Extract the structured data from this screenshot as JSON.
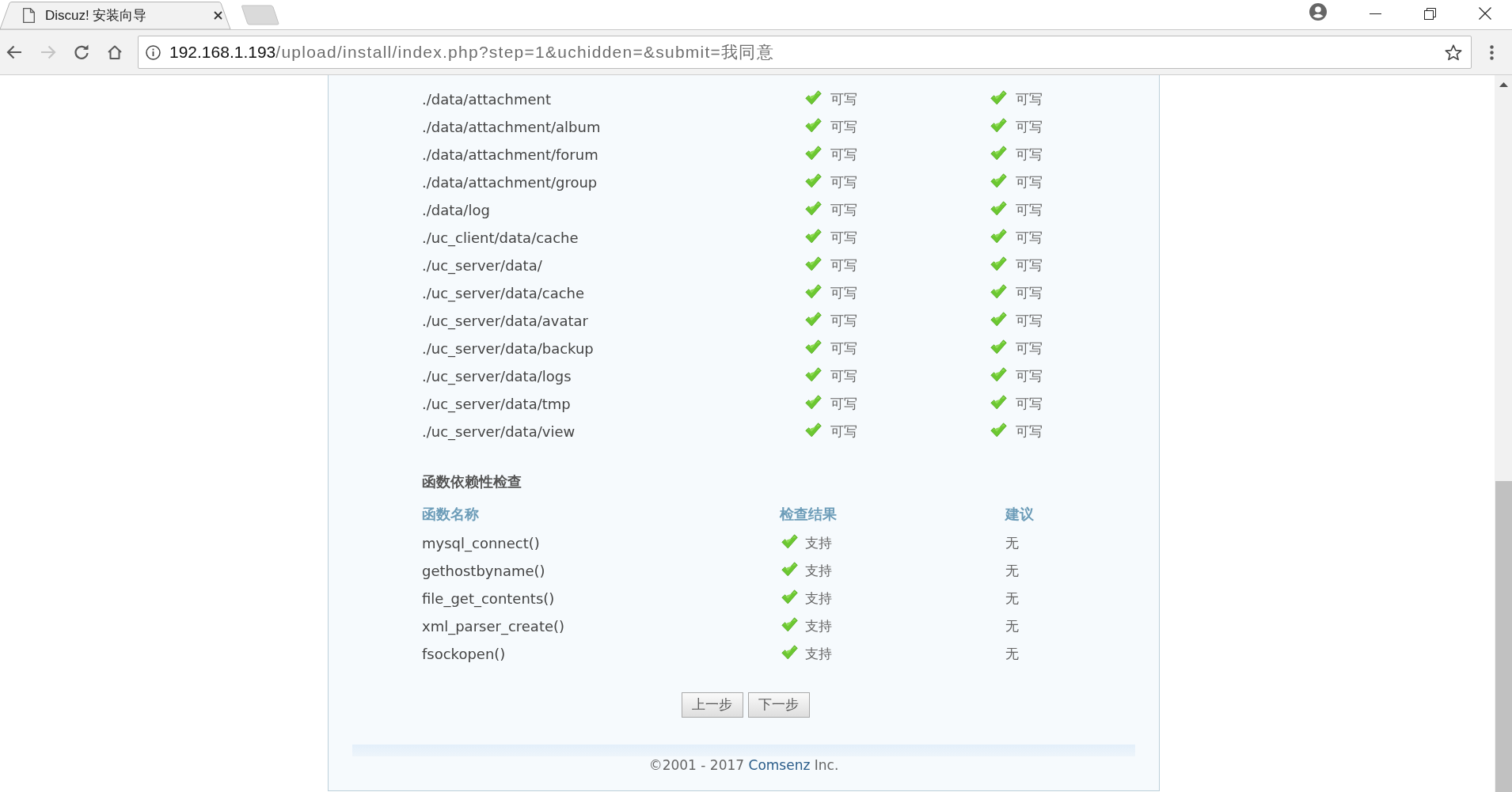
{
  "tabs": [
    {
      "title": "Discuz! 安装向导",
      "selected": true
    }
  ],
  "toolbar": {
    "back": {
      "disabled": false
    },
    "forward": {
      "disabled": true
    }
  },
  "address_bar": {
    "host": "192.168.1.193",
    "path": "/upload/install/index.php?step=1&uchidden=&submit=我同意"
  },
  "directory_check": {
    "rows": [
      {
        "path": "./data/attachment",
        "column_2": {
          "text": "可写",
          "ok": true
        },
        "column_3": {
          "text": "可写",
          "ok": true
        }
      },
      {
        "path": "./data/attachment/album",
        "column_2": {
          "text": "可写",
          "ok": true
        },
        "column_3": {
          "text": "可写",
          "ok": true
        }
      },
      {
        "path": "./data/attachment/forum",
        "column_2": {
          "text": "可写",
          "ok": true
        },
        "column_3": {
          "text": "可写",
          "ok": true
        }
      },
      {
        "path": "./data/attachment/group",
        "column_2": {
          "text": "可写",
          "ok": true
        },
        "column_3": {
          "text": "可写",
          "ok": true
        }
      },
      {
        "path": "./data/log",
        "column_2": {
          "text": "可写",
          "ok": true
        },
        "column_3": {
          "text": "可写",
          "ok": true
        }
      },
      {
        "path": "./uc_client/data/cache",
        "column_2": {
          "text": "可写",
          "ok": true
        },
        "column_3": {
          "text": "可写",
          "ok": true
        }
      },
      {
        "path": "./uc_server/data/",
        "column_2": {
          "text": "可写",
          "ok": true
        },
        "column_3": {
          "text": "可写",
          "ok": true
        }
      },
      {
        "path": "./uc_server/data/cache",
        "column_2": {
          "text": "可写",
          "ok": true
        },
        "column_3": {
          "text": "可写",
          "ok": true
        }
      },
      {
        "path": "./uc_server/data/avatar",
        "column_2": {
          "text": "可写",
          "ok": true
        },
        "column_3": {
          "text": "可写",
          "ok": true
        }
      },
      {
        "path": "./uc_server/data/backup",
        "column_2": {
          "text": "可写",
          "ok": true
        },
        "column_3": {
          "text": "可写",
          "ok": true
        }
      },
      {
        "path": "./uc_server/data/logs",
        "column_2": {
          "text": "可写",
          "ok": true
        },
        "column_3": {
          "text": "可写",
          "ok": true
        }
      },
      {
        "path": "./uc_server/data/tmp",
        "column_2": {
          "text": "可写",
          "ok": true
        },
        "column_3": {
          "text": "可写",
          "ok": true
        }
      },
      {
        "path": "./uc_server/data/view",
        "column_2": {
          "text": "可写",
          "ok": true
        },
        "column_3": {
          "text": "可写",
          "ok": true
        }
      }
    ]
  },
  "function_check": {
    "title": "函数依赖性检查",
    "columns": [
      "函数名称",
      "检查结果",
      "建议"
    ],
    "rows": [
      {
        "name": "mysql_connect()",
        "result": {
          "text": "支持",
          "ok": true
        },
        "advice": "无"
      },
      {
        "name": "gethostbyname()",
        "result": {
          "text": "支持",
          "ok": true
        },
        "advice": "无"
      },
      {
        "name": "file_get_contents()",
        "result": {
          "text": "支持",
          "ok": true
        },
        "advice": "无"
      },
      {
        "name": "xml_parser_create()",
        "result": {
          "text": "支持",
          "ok": true
        },
        "advice": "无"
      },
      {
        "name": "fsockopen()",
        "result": {
          "text": "支持",
          "ok": true
        },
        "advice": "无"
      }
    ]
  },
  "buttons": [
    "上一步",
    "下一步"
  ],
  "footer": {
    "copyright": "©2001 - 2017",
    "link": "Comsenz",
    "suffix": "Inc."
  }
}
